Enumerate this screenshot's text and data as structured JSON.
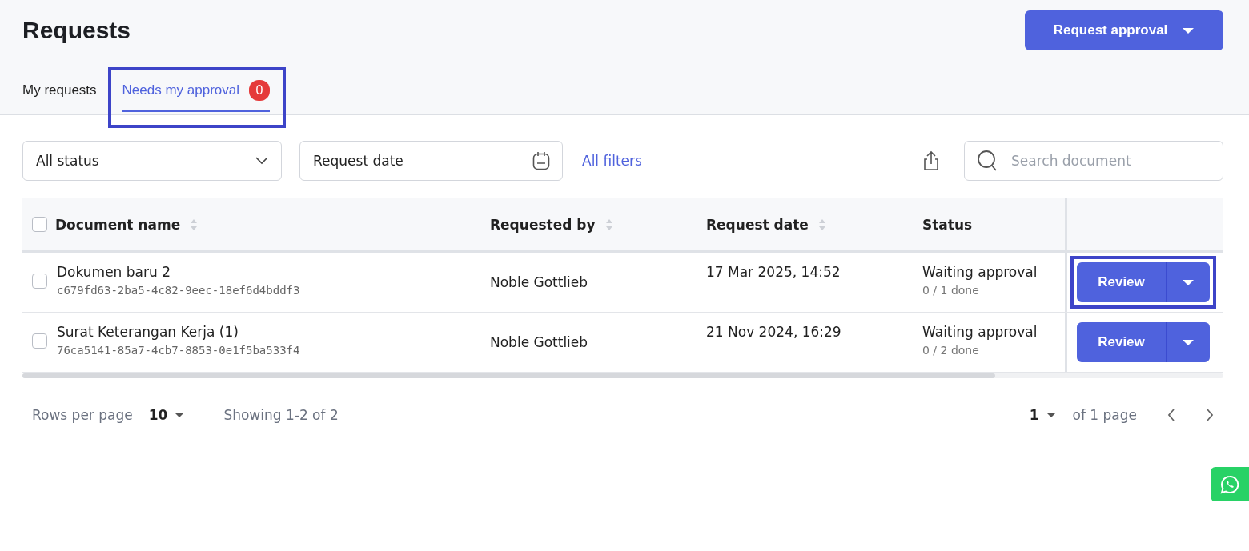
{
  "page": {
    "title": "Requests"
  },
  "request_approval_button": {
    "label": "Request approval"
  },
  "tabs": [
    {
      "label": "My requests",
      "selected": false,
      "highlighted": false
    },
    {
      "label": "Needs my approval",
      "selected": true,
      "highlighted": true,
      "badge": "0"
    }
  ],
  "filters": {
    "status": {
      "value": "All status"
    },
    "date": {
      "placeholder": "Request date"
    },
    "all_filters_link": "All filters",
    "search": {
      "placeholder": "Search document"
    }
  },
  "table": {
    "select_all_checked": false,
    "columns": [
      {
        "label": "Document name",
        "sortable": true
      },
      {
        "label": "Requested by",
        "sortable": true
      },
      {
        "label": "Request date",
        "sortable": true
      },
      {
        "label": "Status",
        "sortable": false
      }
    ],
    "rows": [
      {
        "checked": false,
        "name": "Dokumen baru 2",
        "id": "c679fd63-2ba5-4c82-9eec-18ef6d4bddf3",
        "requested_by": "Noble Gottlieb",
        "date": "17 Mar 2025, 14:52",
        "status": "Waiting approval",
        "progress": "0 / 1 done",
        "action": "Review",
        "highlighted": true
      },
      {
        "checked": false,
        "name": "Surat Keterangan Kerja (1)",
        "id": "76ca5141-85a7-4cb7-8853-0e1f5ba533f4",
        "requested_by": "Noble Gottlieb",
        "date": "21 Nov 2024, 16:29",
        "status": "Waiting approval",
        "progress": "0 / 2 done",
        "action": "Review",
        "highlighted": false
      }
    ]
  },
  "pagination": {
    "rows_per_page_label": "Rows per page",
    "rows_per_page": "10",
    "showing": "Showing 1-2 of 2",
    "page": "1",
    "of_pages": "of 1 page"
  }
}
